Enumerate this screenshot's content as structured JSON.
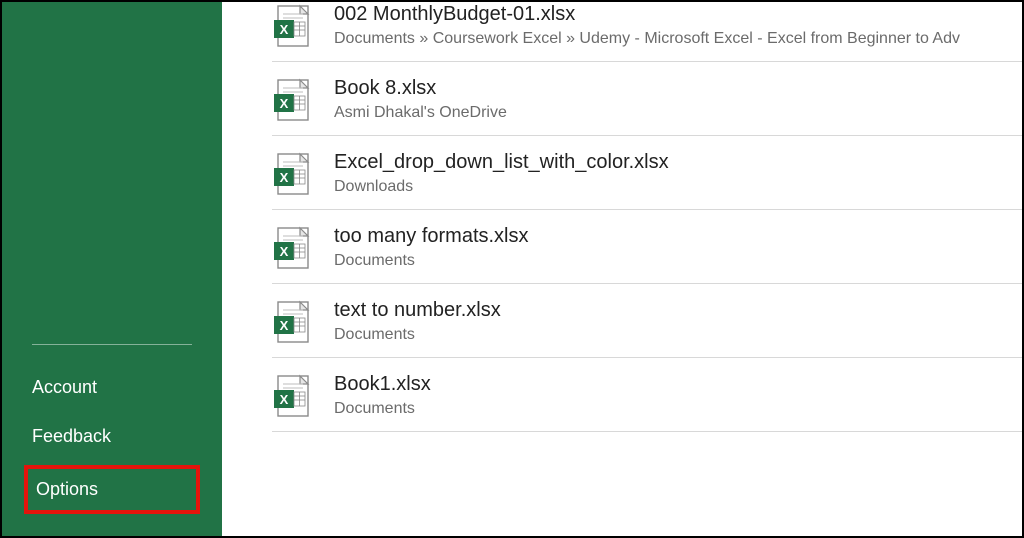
{
  "sidebar": {
    "items": [
      {
        "label": "Account",
        "highlighted": false
      },
      {
        "label": "Feedback",
        "highlighted": false
      },
      {
        "label": "Options",
        "highlighted": true
      }
    ]
  },
  "files": [
    {
      "name": "002 MonthlyBudget-01.xlsx",
      "path": "Documents » Coursework Excel » Udemy - Microsoft Excel - Excel from Beginner to Adv"
    },
    {
      "name": "Book 8.xlsx",
      "path": "Asmi Dhakal's OneDrive"
    },
    {
      "name": "Excel_drop_down_list_with_color.xlsx",
      "path": "Downloads"
    },
    {
      "name": "too many formats.xlsx",
      "path": "Documents"
    },
    {
      "name": "text to number.xlsx",
      "path": "Documents"
    },
    {
      "name": "Book1.xlsx",
      "path": "Documents"
    }
  ],
  "colors": {
    "brand": "#217346",
    "highlight": "#e4140c"
  }
}
